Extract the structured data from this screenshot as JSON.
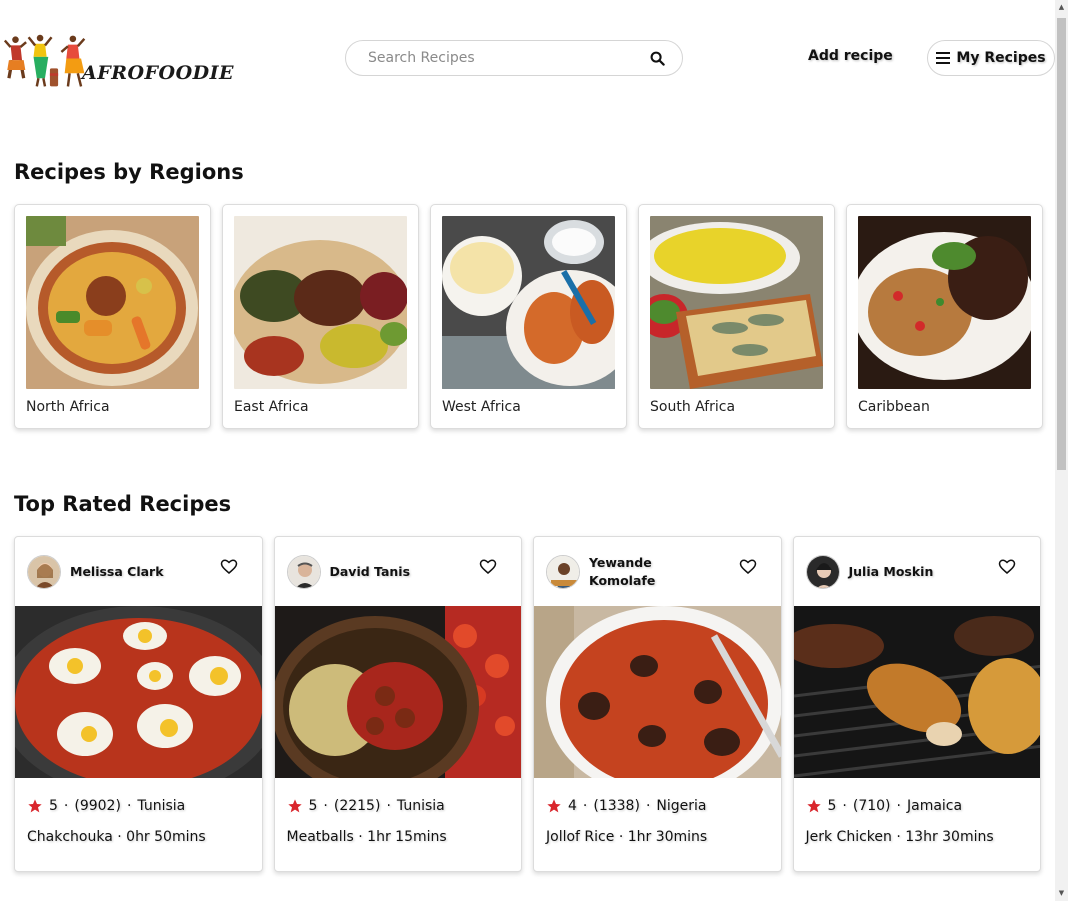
{
  "header": {
    "logo_text": "AFROFOODIE",
    "search_placeholder": "Search Recipes",
    "add_recipe_label": "Add recipe",
    "my_recipes_label": "My Recipes"
  },
  "regions": {
    "title": "Recipes by Regions",
    "items": [
      {
        "label": "North Africa"
      },
      {
        "label": "East Africa"
      },
      {
        "label": "West Africa"
      },
      {
        "label": "South Africa"
      },
      {
        "label": "Caribbean"
      }
    ]
  },
  "top_rated": {
    "title": "Top Rated Recipes",
    "items": [
      {
        "author": "Melissa Clark",
        "rating": "5",
        "reviews": "(9902)",
        "country": "Tunisia",
        "name": "Chakchouka",
        "time": "0hr 50mins"
      },
      {
        "author": "David Tanis",
        "rating": "5",
        "reviews": "(2215)",
        "country": "Tunisia",
        "name": "Meatballs",
        "time": "1hr 15mins"
      },
      {
        "author": "Yewande Komolafe",
        "rating": "4",
        "reviews": "(1338)",
        "country": "Nigeria",
        "name": "Jollof Rice",
        "time": "1hr 30mins"
      },
      {
        "author": "Julia Moskin",
        "rating": "5",
        "reviews": "(710)",
        "country": "Jamaica",
        "name": "Jerk Chicken",
        "time": "13hr 30mins"
      }
    ]
  },
  "colors": {
    "star": "#d9262c",
    "border": "#dcdcdc"
  }
}
